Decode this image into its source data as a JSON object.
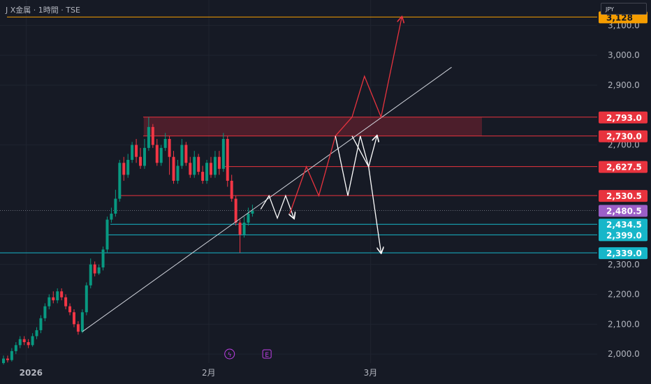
{
  "header": {
    "title": "J X金属 · 1時間 · TSE",
    "currency": "JPY"
  },
  "chart_data": {
    "type": "candlestick",
    "ylim": [
      1970,
      3185
    ],
    "y_ticks": [
      {
        "value": 2000,
        "label": "2,000.0"
      },
      {
        "value": 2100,
        "label": "2,100.0"
      },
      {
        "value": 2200,
        "label": "2,200.0"
      },
      {
        "value": 2300,
        "label": "2,300.0"
      },
      {
        "value": 2700,
        "label": "2,700.0"
      },
      {
        "value": 2900,
        "label": "2,900.0"
      },
      {
        "value": 3000,
        "label": "3,000.0"
      },
      {
        "value": 3100,
        "label": "3,100.0"
      }
    ],
    "x_ticks": [
      {
        "bar": 6,
        "label": "2026",
        "bold": true
      },
      {
        "bar": 50,
        "label": "2月",
        "bold": false
      },
      {
        "bar": 89,
        "label": "3月",
        "bold": false
      }
    ],
    "event_markers": [
      {
        "bar": 55,
        "symbol": "ϟ"
      },
      {
        "bar": 64,
        "symbol": "E"
      }
    ],
    "candles": [
      [
        1970,
        1985,
        1965,
        1995
      ],
      [
        1985,
        1980,
        1972,
        1995
      ],
      [
        1980,
        2010,
        1975,
        2020
      ],
      [
        2010,
        2030,
        2000,
        2040
      ],
      [
        2030,
        2050,
        2020,
        2060
      ],
      [
        2050,
        2040,
        2030,
        2060
      ],
      [
        2040,
        2030,
        2020,
        2050
      ],
      [
        2030,
        2060,
        2025,
        2070
      ],
      [
        2060,
        2080,
        2050,
        2090
      ],
      [
        2080,
        2120,
        2070,
        2130
      ],
      [
        2120,
        2160,
        2110,
        2170
      ],
      [
        2160,
        2190,
        2150,
        2200
      ],
      [
        2190,
        2180,
        2170,
        2210
      ],
      [
        2180,
        2210,
        2170,
        2220
      ],
      [
        2210,
        2190,
        2180,
        2220
      ],
      [
        2190,
        2160,
        2150,
        2200
      ],
      [
        2160,
        2140,
        2130,
        2170
      ],
      [
        2140,
        2100,
        2090,
        2150
      ],
      [
        2100,
        2075,
        2065,
        2110
      ],
      [
        2075,
        2140,
        2070,
        2150
      ],
      [
        2140,
        2230,
        2130,
        2240
      ],
      [
        2230,
        2300,
        2220,
        2320
      ],
      [
        2300,
        2270,
        2260,
        2310
      ],
      [
        2270,
        2290,
        2265,
        2300
      ],
      [
        2290,
        2350,
        2280,
        2360
      ],
      [
        2350,
        2450,
        2340,
        2460
      ],
      [
        2450,
        2470,
        2440,
        2490
      ],
      [
        2470,
        2520,
        2460,
        2550
      ],
      [
        2520,
        2640,
        2510,
        2650
      ],
      [
        2640,
        2600,
        2580,
        2660
      ],
      [
        2600,
        2650,
        2590,
        2670
      ],
      [
        2650,
        2700,
        2640,
        2710
      ],
      [
        2700,
        2660,
        2640,
        2720
      ],
      [
        2660,
        2630,
        2620,
        2690
      ],
      [
        2630,
        2690,
        2620,
        2720
      ],
      [
        2690,
        2760,
        2680,
        2793
      ],
      [
        2760,
        2700,
        2690,
        2770
      ],
      [
        2700,
        2640,
        2630,
        2720
      ],
      [
        2640,
        2690,
        2630,
        2700
      ],
      [
        2690,
        2720,
        2680,
        2740
      ],
      [
        2720,
        2660,
        2600,
        2730
      ],
      [
        2660,
        2580,
        2570,
        2680
      ],
      [
        2580,
        2630,
        2570,
        2650
      ],
      [
        2630,
        2700,
        2620,
        2720
      ],
      [
        2700,
        2640,
        2630,
        2710
      ],
      [
        2640,
        2600,
        2590,
        2660
      ],
      [
        2600,
        2660,
        2590,
        2680
      ],
      [
        2660,
        2610,
        2600,
        2670
      ],
      [
        2610,
        2580,
        2570,
        2630
      ],
      [
        2580,
        2640,
        2570,
        2650
      ],
      [
        2640,
        2600,
        2590,
        2660
      ],
      [
        2600,
        2660,
        2590,
        2680
      ],
      [
        2660,
        2620,
        2600,
        2680
      ],
      [
        2620,
        2720,
        2610,
        2740
      ],
      [
        2720,
        2580,
        2560,
        2730
      ],
      [
        2580,
        2520,
        2510,
        2600
      ],
      [
        2520,
        2440,
        2430,
        2530
      ],
      [
        2440,
        2400,
        2339,
        2450
      ],
      [
        2400,
        2440,
        2390,
        2460
      ],
      [
        2440,
        2470,
        2430,
        2490
      ],
      [
        2470,
        2480,
        2460,
        2500
      ]
    ],
    "horizontal_lines": [
      {
        "value": 3128,
        "color": "#f59d00",
        "label": "3,128"
      },
      {
        "value": 2793,
        "color": "#e8333e",
        "label": "2,793.0"
      },
      {
        "value": 2730,
        "color": "#e8333e",
        "label": "2,730.0"
      },
      {
        "value": 2627.5,
        "color": "#e8333e",
        "label": "2,627.5"
      },
      {
        "value": 2530.5,
        "color": "#e8333e",
        "label": "2,530.5"
      },
      {
        "value": 2480.5,
        "color": "#9c5fc7",
        "label": "2,480.5"
      },
      {
        "value": 2434.5,
        "color": "#17b6c9",
        "label": "2,434.5"
      },
      {
        "value": 2399,
        "color": "#17b6c9",
        "label": "2,399.0"
      },
      {
        "value": 2339,
        "color": "#17b6c9",
        "label": "2,339.0"
      }
    ],
    "resistance_zone": {
      "from": 2730,
      "to": 2793,
      "color": "#7a2332"
    },
    "trendline": {
      "from": {
        "bar": 19,
        "value": 2075
      },
      "to": {
        "bar": 108,
        "value": 2960
      },
      "color": "#d1d4dc"
    },
    "projections": [
      {
        "color": "#ffffff",
        "points": [
          [
            62,
            2485
          ],
          [
            64,
            2530
          ],
          [
            66,
            2455
          ],
          [
            68,
            2530
          ],
          [
            70,
            2455
          ]
        ]
      },
      {
        "color": "#e8333e",
        "points": [
          [
            69,
            2470
          ],
          [
            73,
            2627
          ],
          [
            76,
            2530
          ],
          [
            80,
            2730
          ],
          [
            84,
            2793
          ],
          [
            87,
            2930
          ],
          [
            91,
            2793
          ],
          [
            96,
            3128
          ]
        ]
      },
      {
        "color": "#ffffff",
        "points": [
          [
            80,
            2730
          ],
          [
            83,
            2530
          ],
          [
            86,
            2730
          ],
          [
            88,
            2627
          ],
          [
            90,
            2730
          ]
        ]
      },
      {
        "color": "#ffffff",
        "points": [
          [
            84,
            2730
          ],
          [
            88,
            2627
          ],
          [
            91,
            2339
          ]
        ]
      }
    ]
  }
}
